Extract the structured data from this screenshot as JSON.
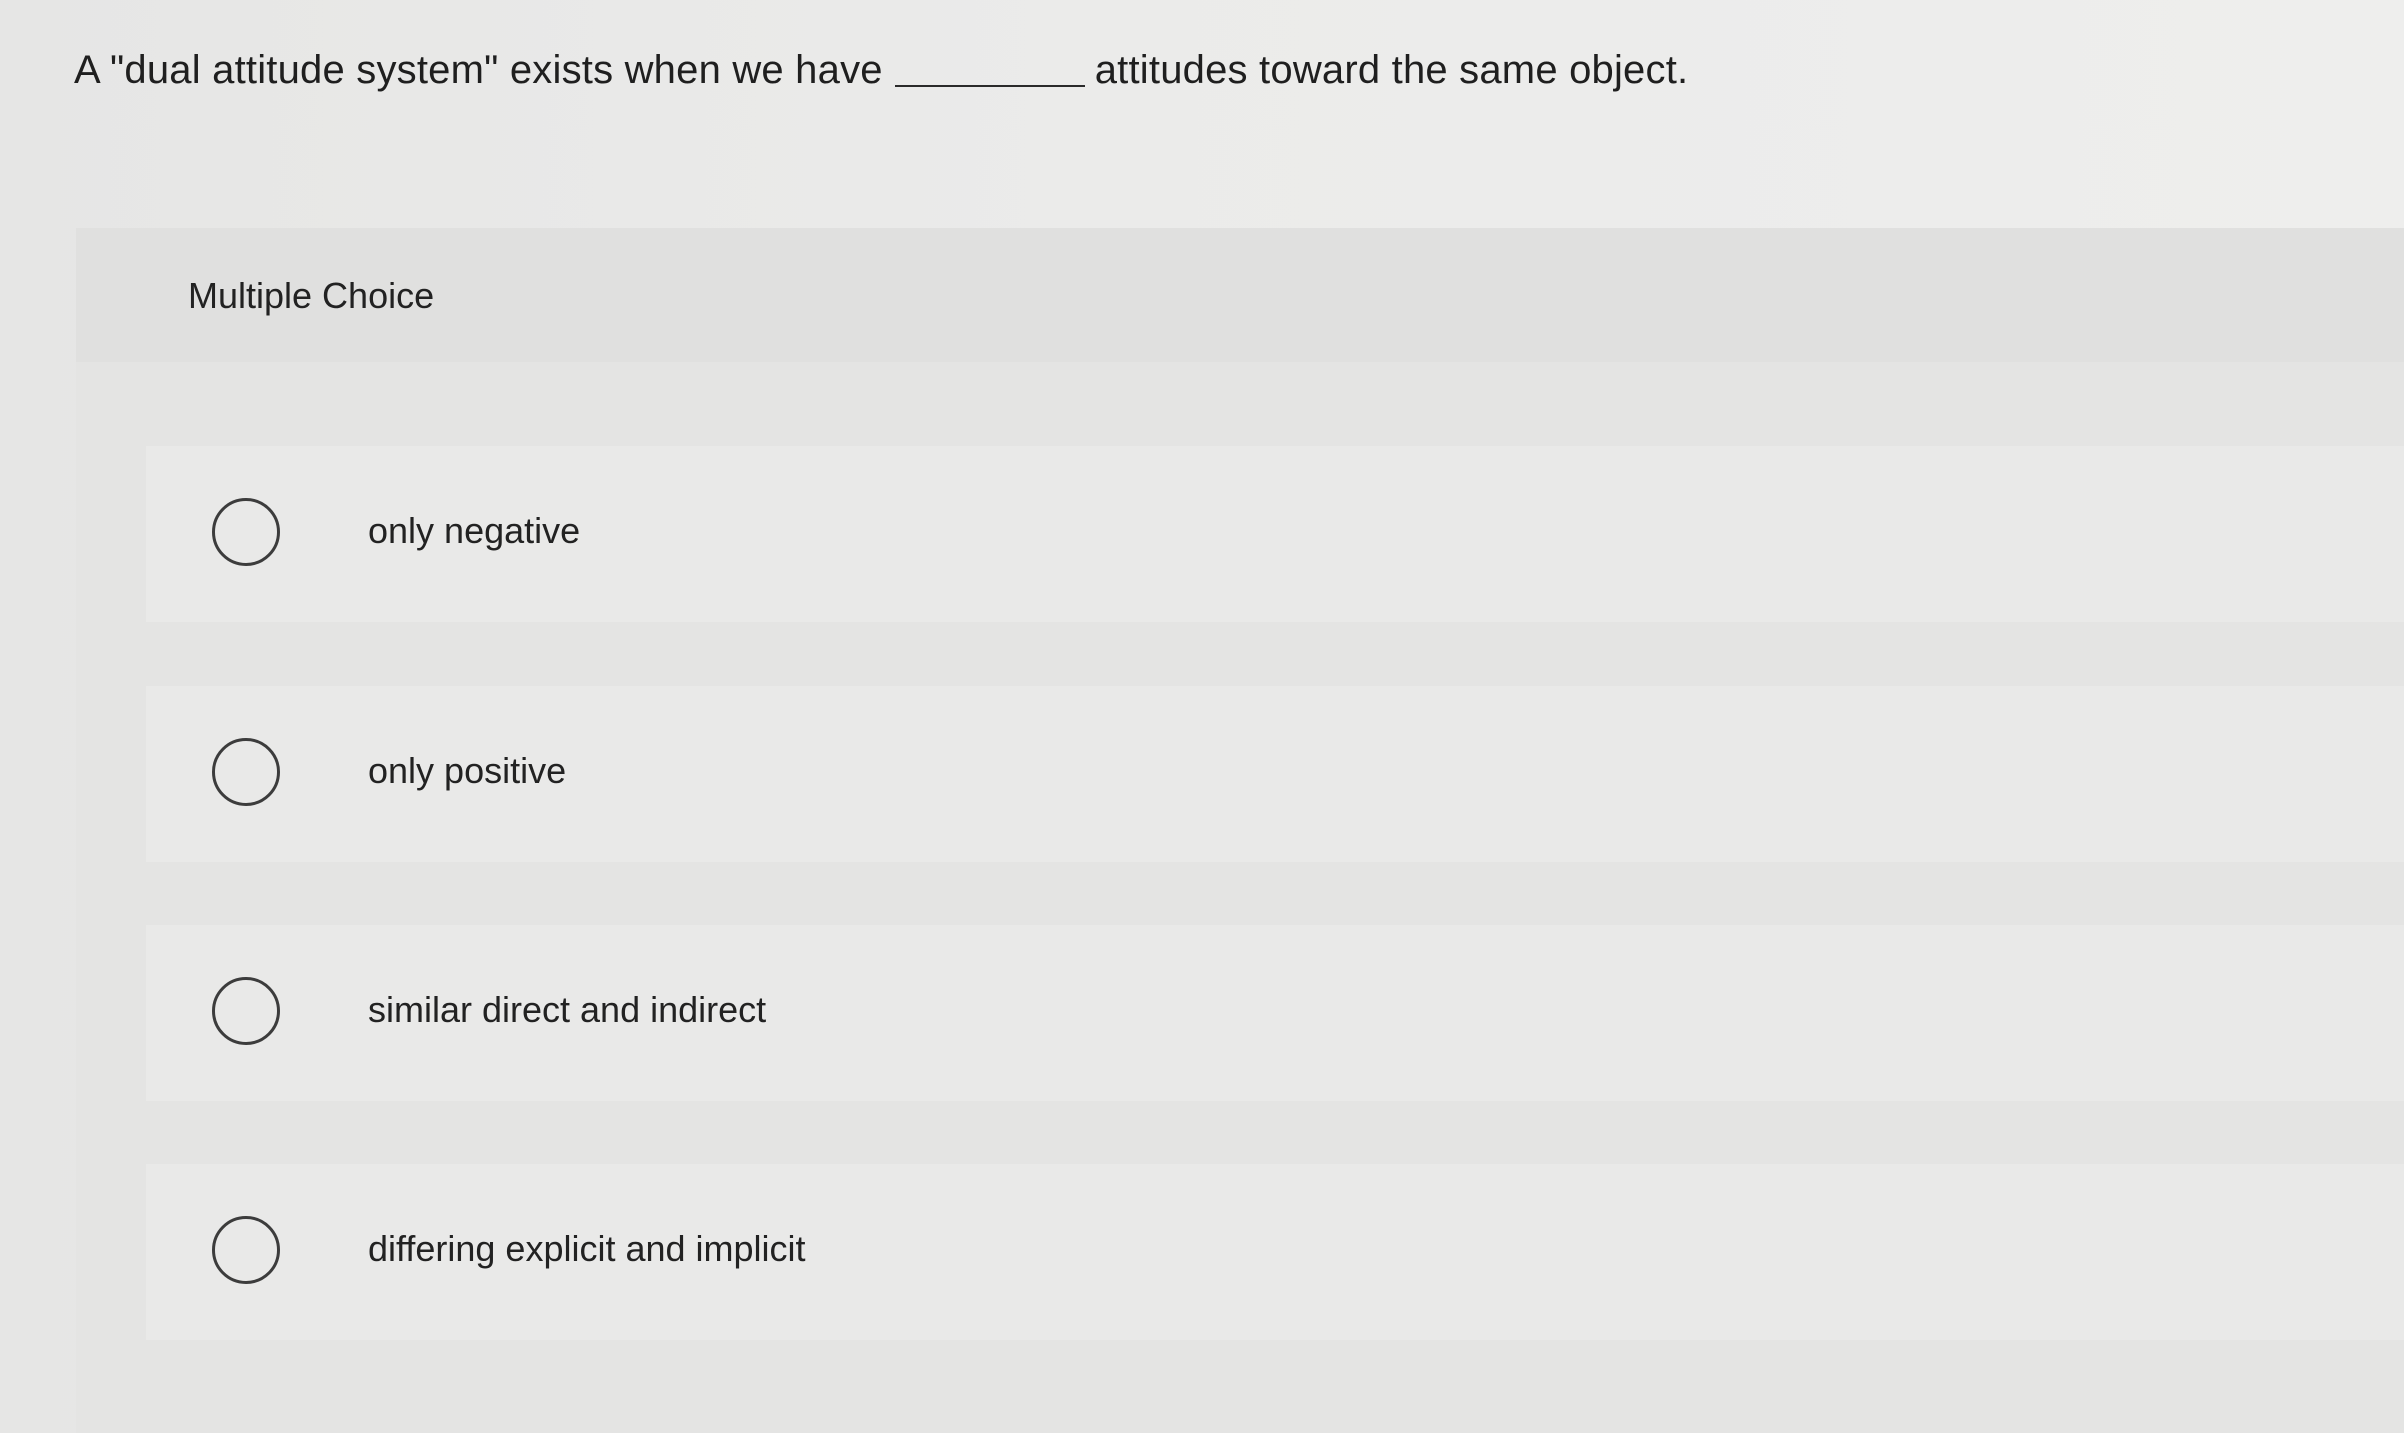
{
  "question": {
    "text_before": "A \"dual attitude system\" exists when we have",
    "text_after": "attitudes toward the same object."
  },
  "question_type": "Multiple Choice",
  "options": [
    {
      "label": "only negative",
      "selected": false
    },
    {
      "label": "only positive",
      "selected": false
    },
    {
      "label": "similar direct and indirect",
      "selected": false
    },
    {
      "label": "differing explicit and implicit",
      "selected": false
    }
  ],
  "icons": {
    "radio": "radio-unchecked-icon"
  }
}
